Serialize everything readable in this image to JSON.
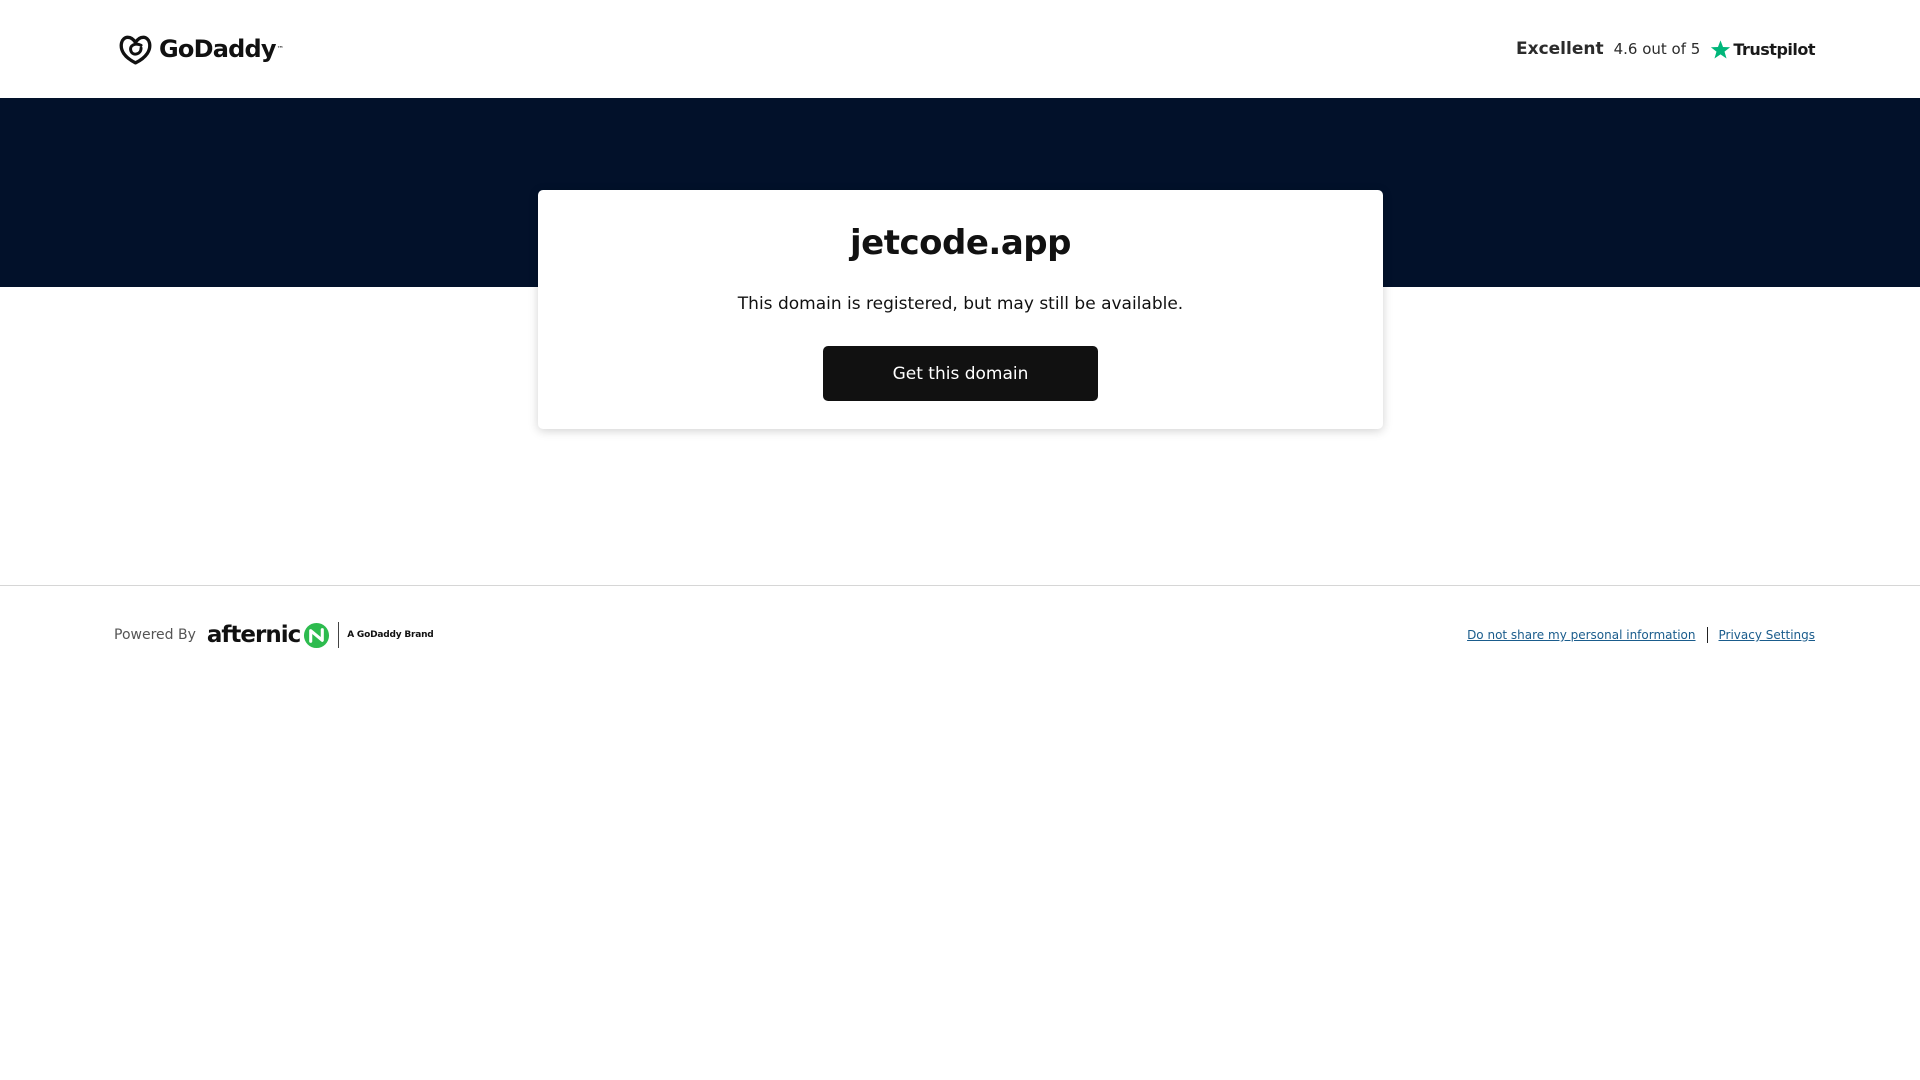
{
  "header": {
    "logo_text": "GoDaddy",
    "trustpilot": {
      "rating_word": "Excellent",
      "score_text": "4.6 out of 5",
      "brand": "Trustpilot",
      "star_color": "#00b67a"
    }
  },
  "colors": {
    "band": "#02112a",
    "button": "#111111",
    "afternic_green": "#2dbb4e",
    "link": "#1a5c8c"
  },
  "main": {
    "domain": "jetcode.app",
    "message": "This domain is registered, but may still be available.",
    "cta_label": "Get this domain"
  },
  "footer": {
    "powered_by": "Powered By",
    "afternic": "afternic",
    "brand_tag": "A GoDaddy Brand",
    "links": [
      "Do not share my personal information",
      "Privacy Settings"
    ]
  }
}
